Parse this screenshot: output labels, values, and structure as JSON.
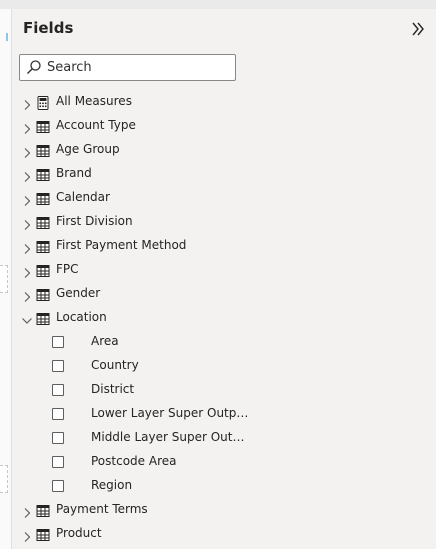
{
  "pane": {
    "title": "Fields",
    "collapse_icon": "double-chevron-right-icon"
  },
  "search": {
    "placeholder": "Search",
    "value": "",
    "icon": "search-icon"
  },
  "tables": [
    {
      "name": "All Measures",
      "icon": "calculator-icon",
      "expanded": false
    },
    {
      "name": "Account Type",
      "icon": "table-icon",
      "expanded": false
    },
    {
      "name": "Age Group",
      "icon": "table-icon",
      "expanded": false
    },
    {
      "name": "Brand",
      "icon": "table-icon",
      "expanded": false
    },
    {
      "name": "Calendar",
      "icon": "table-icon",
      "expanded": false
    },
    {
      "name": "First Division",
      "icon": "table-icon",
      "expanded": false
    },
    {
      "name": "First Payment Method",
      "icon": "table-icon",
      "expanded": false
    },
    {
      "name": "FPC",
      "icon": "table-icon",
      "expanded": false
    },
    {
      "name": "Gender",
      "icon": "table-icon",
      "expanded": false
    },
    {
      "name": "Location",
      "icon": "table-icon",
      "expanded": true,
      "fields": [
        "Area",
        "Country",
        "District",
        "Lower Layer Super Outpu...",
        "Middle Layer Super Outp...",
        "Postcode Area",
        "Region"
      ]
    },
    {
      "name": "Payment Terms",
      "icon": "table-icon",
      "expanded": false
    },
    {
      "name": "Product",
      "icon": "table-icon",
      "expanded": false
    }
  ]
}
